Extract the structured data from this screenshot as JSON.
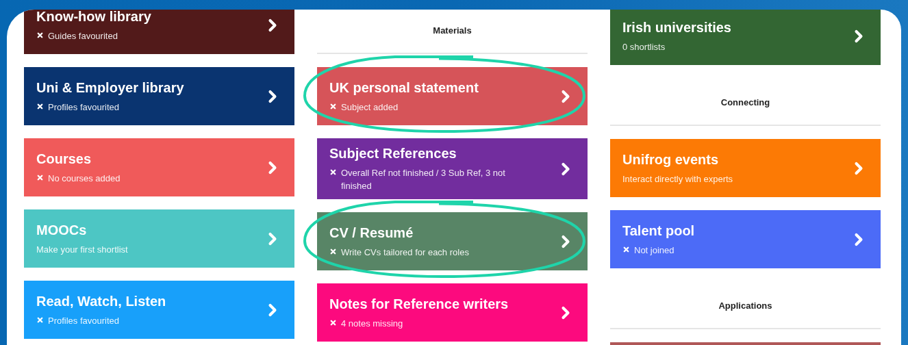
{
  "columns": [
    {
      "items": [
        {
          "kind": "card",
          "title": "Know-how library",
          "subtitle": "Guides favourited",
          "missing": true,
          "highlighted": false,
          "color": "#521a1a"
        },
        {
          "kind": "card",
          "title": "Uni & Employer library",
          "subtitle": "Profiles favourited",
          "missing": true,
          "highlighted": false,
          "color": "#0a3470"
        },
        {
          "kind": "card",
          "title": "Courses",
          "subtitle": "No courses added",
          "missing": true,
          "highlighted": false,
          "color": "#f05a5a"
        },
        {
          "kind": "card",
          "title": "MOOCs",
          "subtitle": "Make your first shortlist",
          "missing": false,
          "highlighted": false,
          "color": "#4dc6c4"
        },
        {
          "kind": "card",
          "title": "Read, Watch, Listen",
          "subtitle": "Profiles favourited",
          "missing": true,
          "highlighted": false,
          "color": "#18a0fa"
        }
      ]
    },
    {
      "items": [
        {
          "kind": "heading",
          "title": "Materials"
        },
        {
          "kind": "card",
          "title": "UK personal statement",
          "subtitle": "Subject added",
          "missing": true,
          "highlighted": true,
          "color": "#d65459"
        },
        {
          "kind": "card",
          "title": "Subject References",
          "subtitle": "Overall Ref not finished / 3 Sub Ref, 3 not finished",
          "missing": true,
          "highlighted": false,
          "color": "#722d9e"
        },
        {
          "kind": "card",
          "title": "CV / Resumé",
          "subtitle": "Write CVs tailored for each roles",
          "missing": true,
          "highlighted": true,
          "color": "#588566"
        },
        {
          "kind": "card",
          "title": "Notes for Reference writers",
          "subtitle": "4 notes missing",
          "missing": true,
          "highlighted": false,
          "color": "#fc0a7e"
        }
      ]
    },
    {
      "items": [
        {
          "kind": "card",
          "title": "Irish universities",
          "subtitle": "0 shortlists",
          "missing": false,
          "highlighted": false,
          "color": "#336633"
        },
        {
          "kind": "heading",
          "title": "Connecting"
        },
        {
          "kind": "card",
          "title": "Unifrog events",
          "subtitle": "Interact directly with experts",
          "missing": false,
          "highlighted": false,
          "color": "#fc7a05"
        },
        {
          "kind": "card",
          "title": "Talent pool",
          "subtitle": "Not joined",
          "missing": true,
          "highlighted": false,
          "color": "#4c6bf7"
        },
        {
          "kind": "heading",
          "title": "Applications"
        },
        {
          "kind": "card",
          "missing": false,
          "highlighted": false,
          "color": "#b05858"
        }
      ]
    }
  ]
}
